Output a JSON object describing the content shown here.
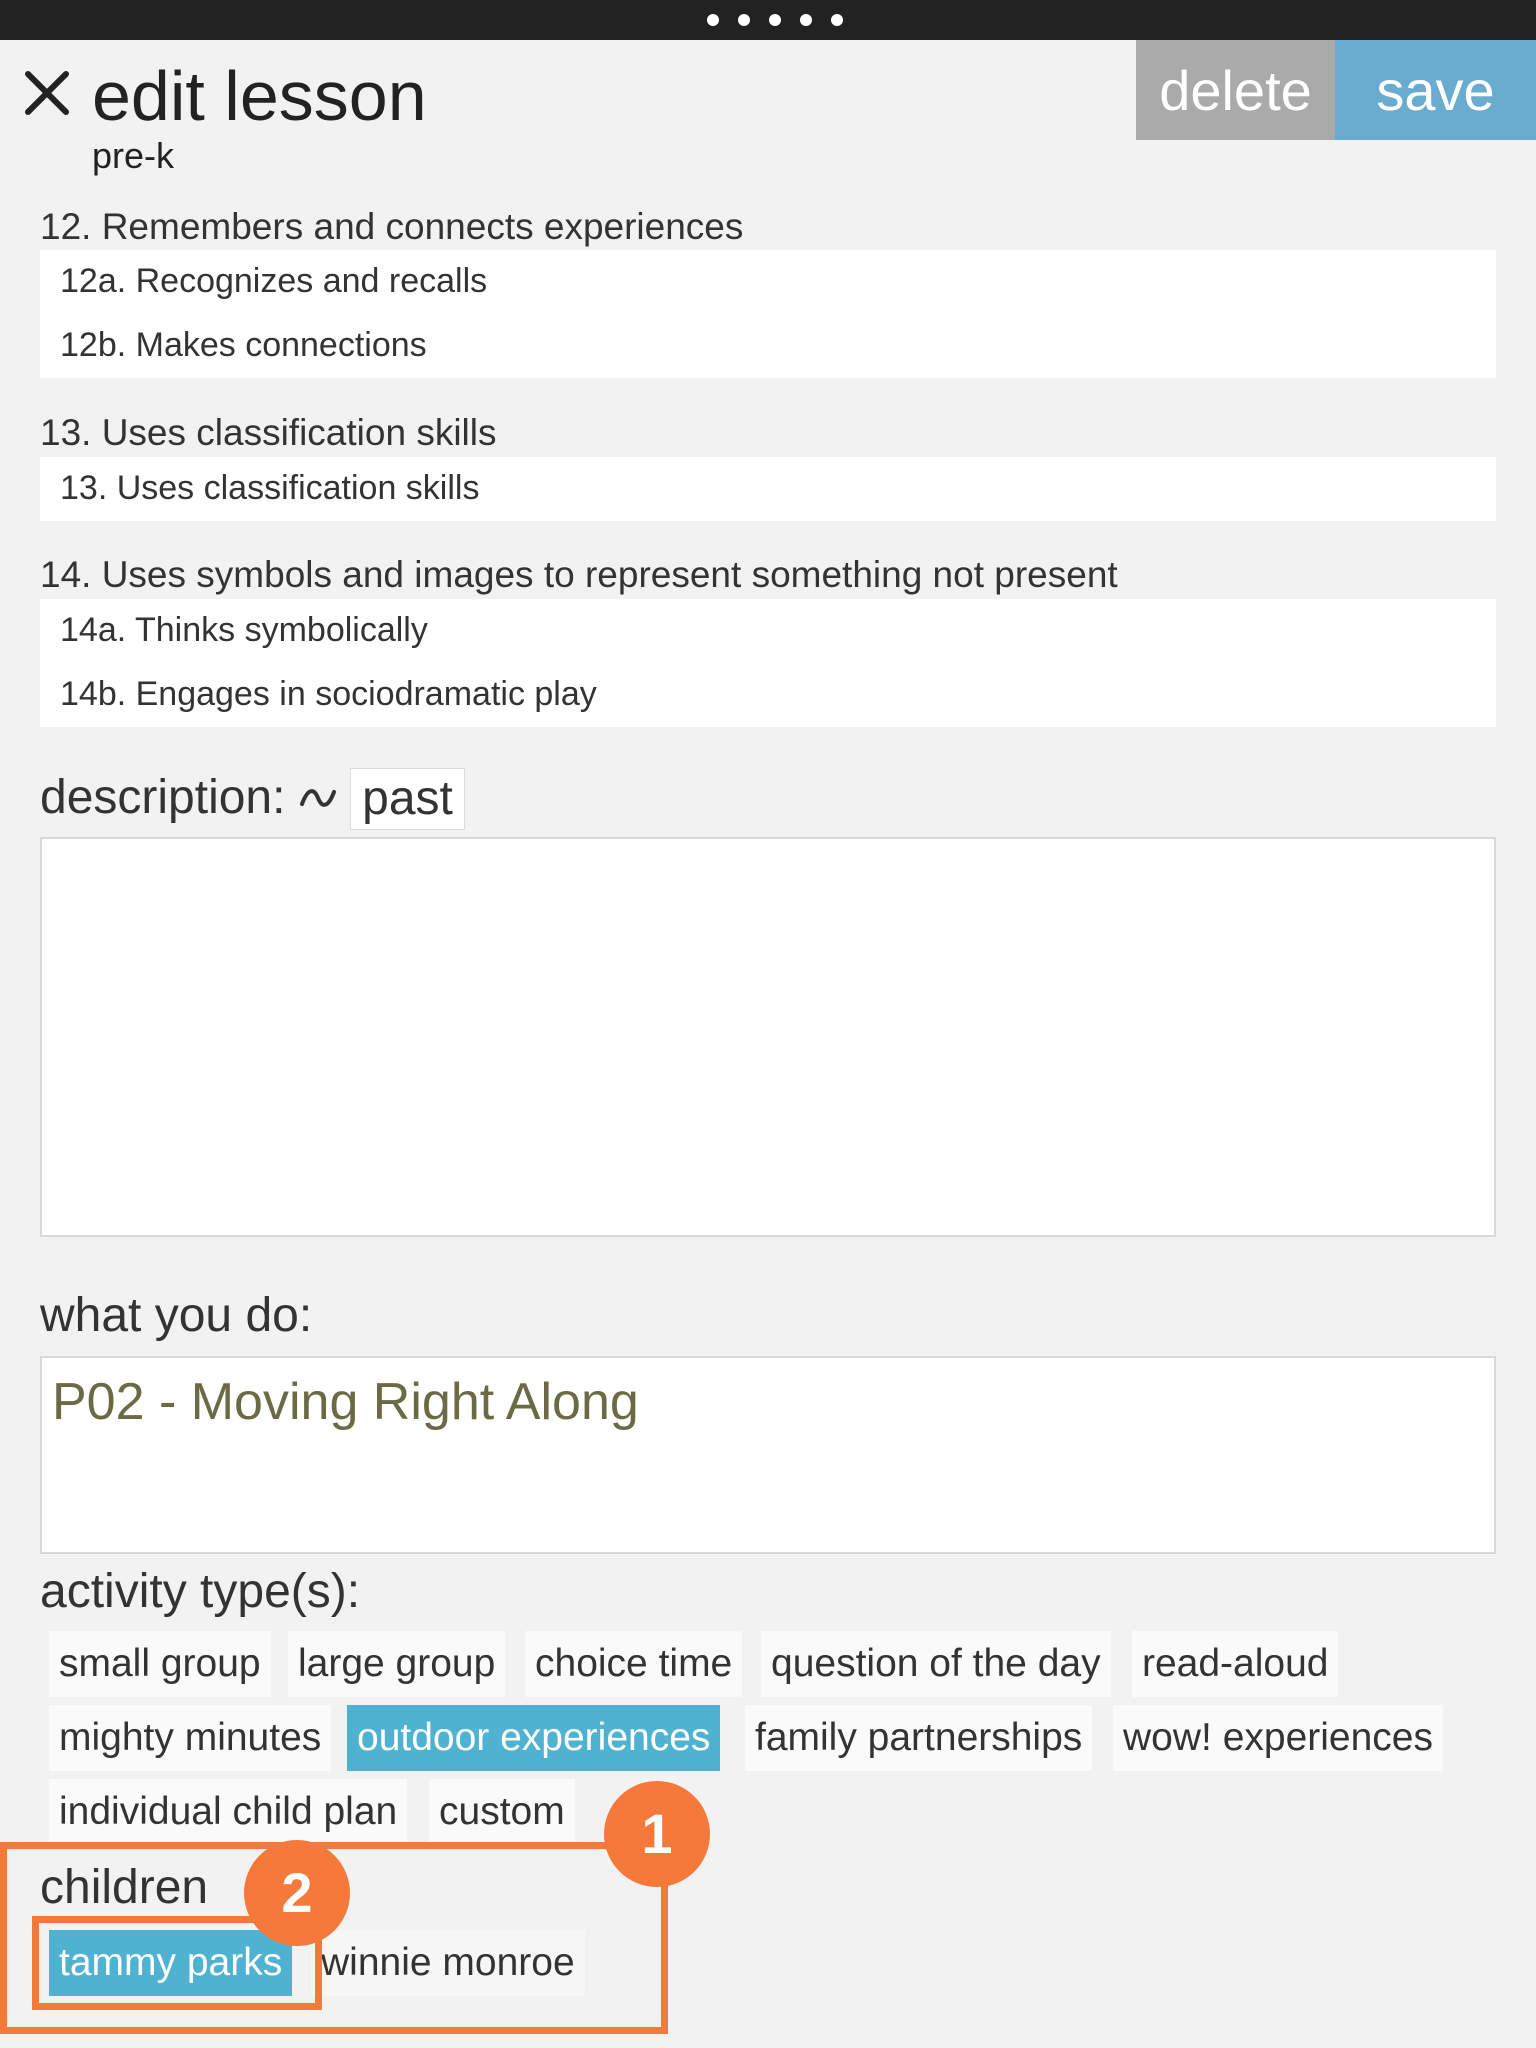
{
  "header": {
    "title": "edit lesson",
    "subtitle": "pre-k",
    "delete_label": "delete",
    "save_label": "save"
  },
  "standards": [
    {
      "title": "12. Remembers and connects experiences",
      "items": [
        "12a. Recognizes and recalls",
        "12b. Makes connections"
      ]
    },
    {
      "title": "13. Uses classification skills",
      "items": [
        "13. Uses classification skills"
      ]
    },
    {
      "title": "14. Uses symbols and images to represent something not present",
      "items": [
        "14a. Thinks symbolically",
        "14b. Engages in sociodramatic play"
      ]
    }
  ],
  "description": {
    "label": "description:",
    "past_label": "past",
    "value": ""
  },
  "what_you_do": {
    "label": "what you do:",
    "value": "P02 - Moving Right Along"
  },
  "activity_types": {
    "label": "activity type(s):",
    "options": [
      {
        "label": "small group",
        "selected": false
      },
      {
        "label": "large group",
        "selected": false
      },
      {
        "label": "choice time",
        "selected": false
      },
      {
        "label": "question of the day",
        "selected": false
      },
      {
        "label": "read-aloud",
        "selected": false
      },
      {
        "label": "mighty minutes",
        "selected": false
      },
      {
        "label": "outdoor experiences",
        "selected": true
      },
      {
        "label": "family partnerships",
        "selected": false
      },
      {
        "label": "wow! experiences",
        "selected": false
      },
      {
        "label": "individual child plan",
        "selected": false
      },
      {
        "label": "custom",
        "selected": false
      }
    ]
  },
  "children": {
    "label": "children",
    "options": [
      {
        "label": "tammy parks",
        "selected": true
      },
      {
        "label": "winnie monroe",
        "selected": false
      }
    ]
  },
  "annotations": [
    "1",
    "2"
  ],
  "colors": {
    "accent": "#4fb2d1",
    "save": "#6aacd0",
    "delete": "#aaaaaa",
    "annotation": "#f5793b",
    "activity_text": "#6b6a44"
  }
}
